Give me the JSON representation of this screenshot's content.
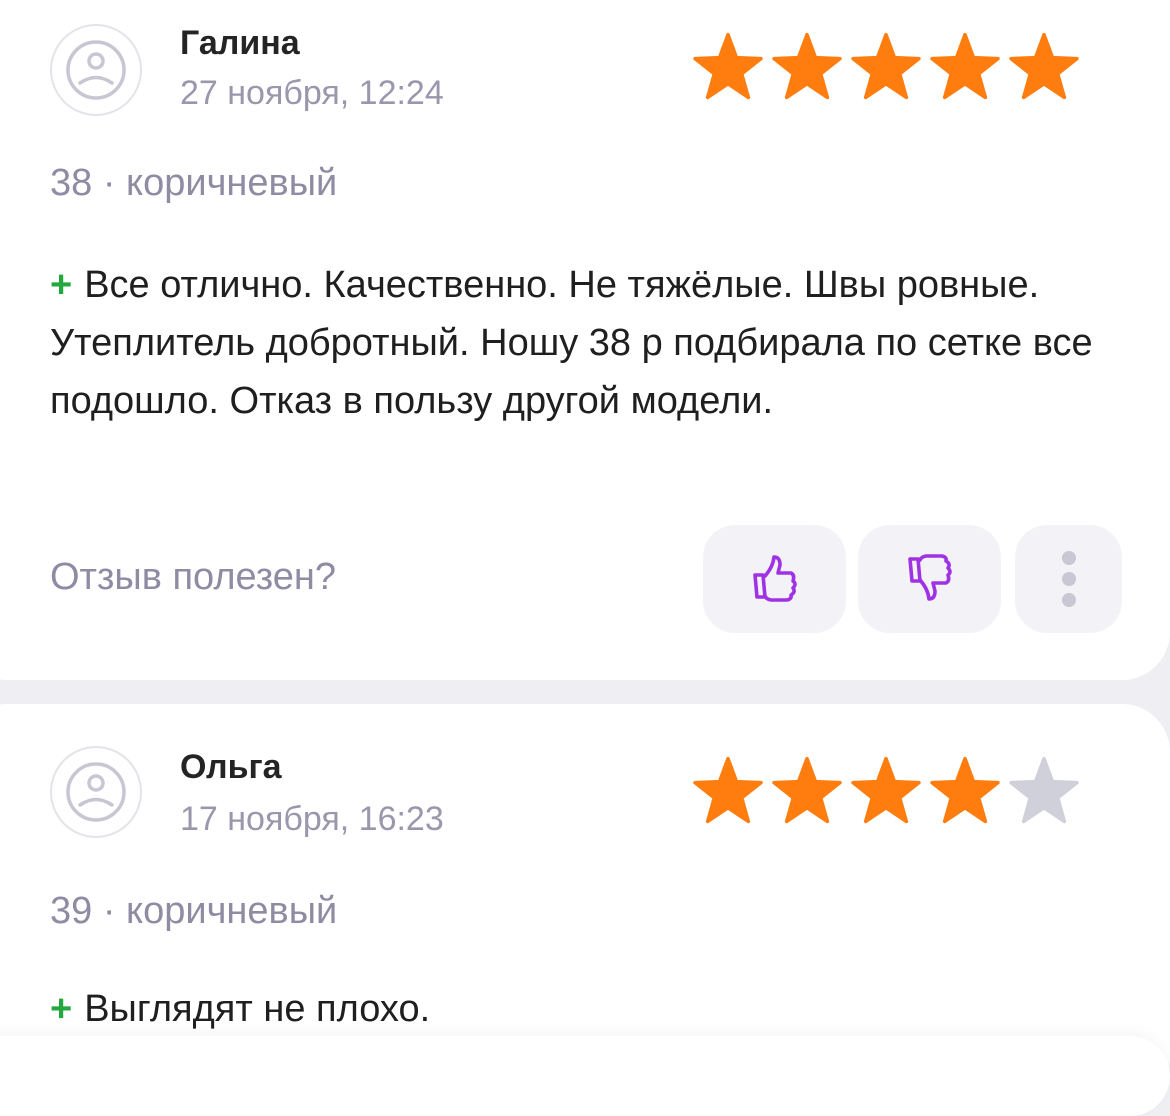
{
  "colors": {
    "star_filled": "#ff7d0f",
    "star_empty": "#cfd0da",
    "accent": "#a032e6",
    "plus": "#22a83c"
  },
  "reviews": [
    {
      "author": "Галина",
      "date": "27 ноября, 12:24",
      "rating": 5,
      "rating_max": 5,
      "variant": "38 · коричневый",
      "plus_sign": "+",
      "text": "Все отлично. Качественно. Не тяжёлые. Швы ровные. Утеплитель добротный. Ношу 38 р подбирала по сетке все подошло. Отказ в пользу другой модели.",
      "helpful_question": "Отзыв полезен?",
      "icons": [
        "avatar-placeholder-icon",
        "thumbs-up-icon",
        "thumbs-down-icon",
        "more-vertical-icon"
      ]
    },
    {
      "author": "Ольга",
      "date": "17 ноября, 16:23",
      "rating": 4,
      "rating_max": 5,
      "variant": "39 · коричневый",
      "plus_sign": "+",
      "text": "Выглядят не плохо."
    }
  ]
}
